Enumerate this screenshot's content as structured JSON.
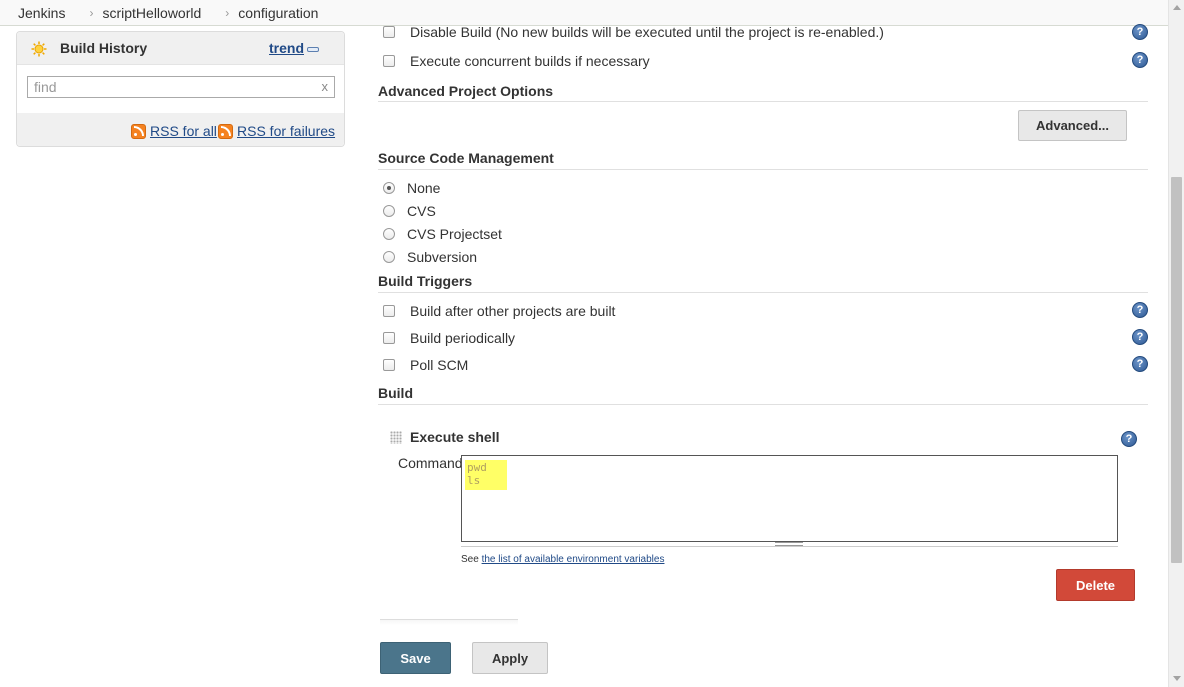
{
  "breadcrumb": [
    "Jenkins",
    "scriptHelloworld",
    "configuration"
  ],
  "breadcrumb_separator": "›",
  "sidebar": {
    "build_history": {
      "title": "Build History",
      "trend_label": "trend",
      "find_placeholder": "find",
      "clear_label": "x",
      "rss_all": "RSS for all",
      "rss_failures": "RSS for failures"
    }
  },
  "general": {
    "disable_build": "Disable Build (No new builds will be executed until the project is re-enabled.)",
    "concurrent": "Execute concurrent builds if necessary"
  },
  "advanced_options": {
    "title": "Advanced Project Options",
    "button": "Advanced..."
  },
  "scm": {
    "title": "Source Code Management",
    "options": [
      "None",
      "CVS",
      "CVS Projectset",
      "Subversion"
    ],
    "selected": "None"
  },
  "triggers": {
    "title": "Build Triggers",
    "options": [
      "Build after other projects are built",
      "Build periodically",
      "Poll SCM"
    ]
  },
  "build": {
    "title": "Build",
    "step_title": "Execute shell",
    "command_label": "Command",
    "command_value": "pwd\nls",
    "see_prefix": "See ",
    "see_link": "the list of available environment variables",
    "delete_button": "Delete"
  },
  "help_icon": "?",
  "icons": {
    "help": "question-circle-icon",
    "rss": "rss-icon",
    "sun": "sun-weather-icon"
  },
  "colors": {
    "save": "#4b758b",
    "delete": "#d24939",
    "link": "#204a87",
    "highlight": "#ffff66"
  },
  "actions": {
    "save": "Save",
    "apply": "Apply"
  }
}
